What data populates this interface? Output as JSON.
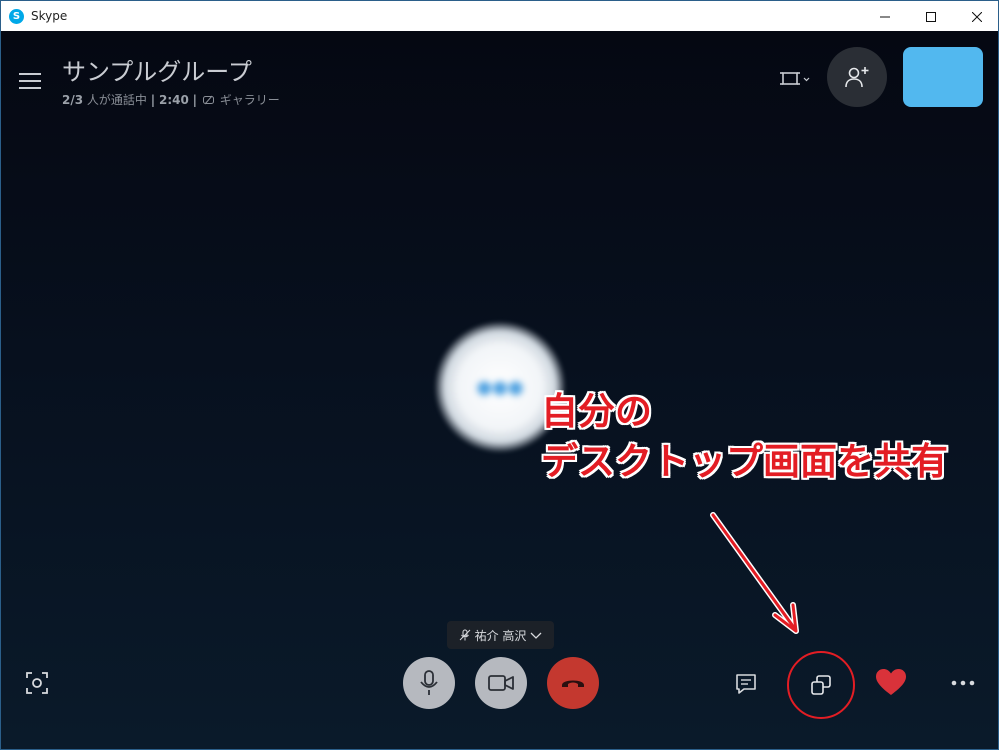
{
  "window": {
    "app_title": "Skype",
    "app_icon_letter": "S"
  },
  "call": {
    "group_title": "サンプルグループ",
    "participants": "2/3",
    "status_text": "人が通話中",
    "duration": "2:40",
    "view_mode": "ギャラリー"
  },
  "speaker": {
    "name": "祐介 高沢"
  },
  "annotation": {
    "line1": "自分の",
    "line2": "デスクトップ画面を共有"
  },
  "colors": {
    "accent_red": "#e31d24",
    "self_video": "#52b8ef",
    "hangup": "#c4382f",
    "heart": "#d9323a"
  },
  "icons": [
    "menu-icon",
    "layout-icon",
    "add-person-icon",
    "mic-icon",
    "video-icon",
    "hangup-icon",
    "screenshot-icon",
    "chat-icon",
    "share-screen-icon",
    "heart-icon",
    "more-icon",
    "mic-muted-icon",
    "chevron-down-icon",
    "gallery-icon"
  ]
}
